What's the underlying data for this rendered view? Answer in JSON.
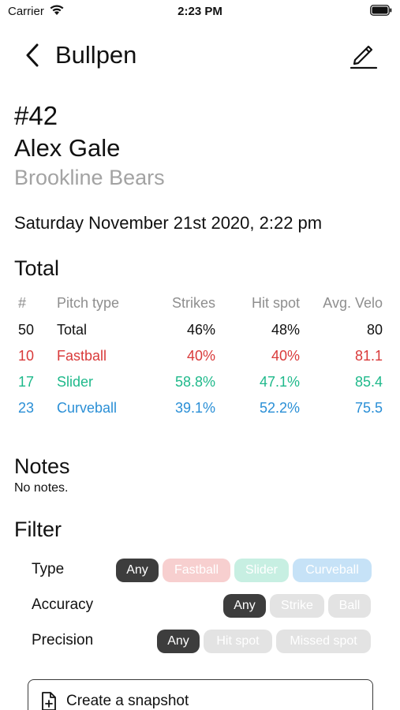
{
  "status_bar": {
    "carrier": "Carrier",
    "time": "2:23 PM"
  },
  "nav": {
    "title": "Bullpen",
    "back_icon": "chevron-left-icon",
    "edit_icon": "pencil-icon"
  },
  "player": {
    "number": "#42",
    "name": "Alex Gale",
    "team": "Brookline Bears"
  },
  "session": {
    "date": "Saturday November 21st 2020, 2:22 pm"
  },
  "total": {
    "heading": "Total",
    "columns": [
      "#",
      "Pitch type",
      "Strikes",
      "Hit spot",
      "Avg. Velo"
    ],
    "rows": [
      {
        "count": "50",
        "type": "Total",
        "strikes": "46%",
        "hit_spot": "48%",
        "avg_velo": "80",
        "color": "#111111"
      },
      {
        "count": "10",
        "type": "Fastball",
        "strikes": "40%",
        "hit_spot": "40%",
        "avg_velo": "81.1",
        "color": "#d93a3a"
      },
      {
        "count": "17",
        "type": "Slider",
        "strikes": "58.8%",
        "hit_spot": "47.1%",
        "avg_velo": "85.4",
        "color": "#1fb98b"
      },
      {
        "count": "23",
        "type": "Curveball",
        "strikes": "39.1%",
        "hit_spot": "52.2%",
        "avg_velo": "75.5",
        "color": "#2a8fd6"
      }
    ]
  },
  "notes": {
    "heading": "Notes",
    "text": "No notes."
  },
  "filter": {
    "heading": "Filter",
    "type": {
      "label": "Type",
      "options": [
        "Any",
        "Fastball",
        "Slider",
        "Curveball"
      ],
      "selected": "Any"
    },
    "accuracy": {
      "label": "Accuracy",
      "options": [
        "Any",
        "Strike",
        "Ball"
      ],
      "selected": "Any"
    },
    "precision": {
      "label": "Precision",
      "options": [
        "Any",
        "Hit spot",
        "Missed spot"
      ],
      "selected": "Any"
    }
  },
  "snapshot": {
    "label": "Create a snapshot",
    "icon": "file-plus-icon"
  }
}
